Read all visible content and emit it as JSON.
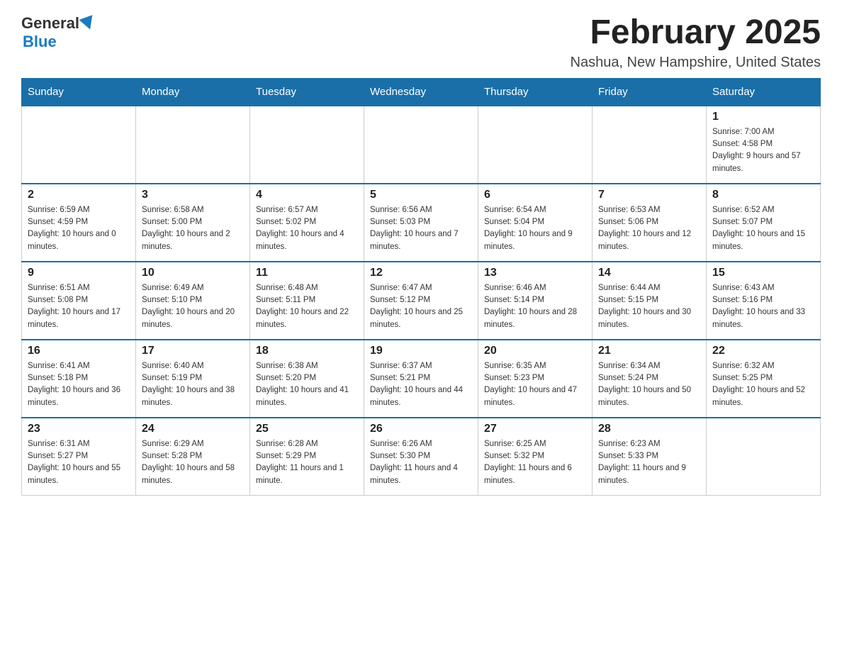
{
  "header": {
    "logo": {
      "text_general": "General",
      "text_blue": "Blue"
    },
    "title": "February 2025",
    "subtitle": "Nashua, New Hampshire, United States"
  },
  "calendar": {
    "days_of_week": [
      "Sunday",
      "Monday",
      "Tuesday",
      "Wednesday",
      "Thursday",
      "Friday",
      "Saturday"
    ],
    "weeks": [
      [
        {
          "day": "",
          "empty": true
        },
        {
          "day": "",
          "empty": true
        },
        {
          "day": "",
          "empty": true
        },
        {
          "day": "",
          "empty": true
        },
        {
          "day": "",
          "empty": true
        },
        {
          "day": "",
          "empty": true
        },
        {
          "day": "1",
          "sunrise": "Sunrise: 7:00 AM",
          "sunset": "Sunset: 4:58 PM",
          "daylight": "Daylight: 9 hours and 57 minutes."
        }
      ],
      [
        {
          "day": "2",
          "sunrise": "Sunrise: 6:59 AM",
          "sunset": "Sunset: 4:59 PM",
          "daylight": "Daylight: 10 hours and 0 minutes."
        },
        {
          "day": "3",
          "sunrise": "Sunrise: 6:58 AM",
          "sunset": "Sunset: 5:00 PM",
          "daylight": "Daylight: 10 hours and 2 minutes."
        },
        {
          "day": "4",
          "sunrise": "Sunrise: 6:57 AM",
          "sunset": "Sunset: 5:02 PM",
          "daylight": "Daylight: 10 hours and 4 minutes."
        },
        {
          "day": "5",
          "sunrise": "Sunrise: 6:56 AM",
          "sunset": "Sunset: 5:03 PM",
          "daylight": "Daylight: 10 hours and 7 minutes."
        },
        {
          "day": "6",
          "sunrise": "Sunrise: 6:54 AM",
          "sunset": "Sunset: 5:04 PM",
          "daylight": "Daylight: 10 hours and 9 minutes."
        },
        {
          "day": "7",
          "sunrise": "Sunrise: 6:53 AM",
          "sunset": "Sunset: 5:06 PM",
          "daylight": "Daylight: 10 hours and 12 minutes."
        },
        {
          "day": "8",
          "sunrise": "Sunrise: 6:52 AM",
          "sunset": "Sunset: 5:07 PM",
          "daylight": "Daylight: 10 hours and 15 minutes."
        }
      ],
      [
        {
          "day": "9",
          "sunrise": "Sunrise: 6:51 AM",
          "sunset": "Sunset: 5:08 PM",
          "daylight": "Daylight: 10 hours and 17 minutes."
        },
        {
          "day": "10",
          "sunrise": "Sunrise: 6:49 AM",
          "sunset": "Sunset: 5:10 PM",
          "daylight": "Daylight: 10 hours and 20 minutes."
        },
        {
          "day": "11",
          "sunrise": "Sunrise: 6:48 AM",
          "sunset": "Sunset: 5:11 PM",
          "daylight": "Daylight: 10 hours and 22 minutes."
        },
        {
          "day": "12",
          "sunrise": "Sunrise: 6:47 AM",
          "sunset": "Sunset: 5:12 PM",
          "daylight": "Daylight: 10 hours and 25 minutes."
        },
        {
          "day": "13",
          "sunrise": "Sunrise: 6:46 AM",
          "sunset": "Sunset: 5:14 PM",
          "daylight": "Daylight: 10 hours and 28 minutes."
        },
        {
          "day": "14",
          "sunrise": "Sunrise: 6:44 AM",
          "sunset": "Sunset: 5:15 PM",
          "daylight": "Daylight: 10 hours and 30 minutes."
        },
        {
          "day": "15",
          "sunrise": "Sunrise: 6:43 AM",
          "sunset": "Sunset: 5:16 PM",
          "daylight": "Daylight: 10 hours and 33 minutes."
        }
      ],
      [
        {
          "day": "16",
          "sunrise": "Sunrise: 6:41 AM",
          "sunset": "Sunset: 5:18 PM",
          "daylight": "Daylight: 10 hours and 36 minutes."
        },
        {
          "day": "17",
          "sunrise": "Sunrise: 6:40 AM",
          "sunset": "Sunset: 5:19 PM",
          "daylight": "Daylight: 10 hours and 38 minutes."
        },
        {
          "day": "18",
          "sunrise": "Sunrise: 6:38 AM",
          "sunset": "Sunset: 5:20 PM",
          "daylight": "Daylight: 10 hours and 41 minutes."
        },
        {
          "day": "19",
          "sunrise": "Sunrise: 6:37 AM",
          "sunset": "Sunset: 5:21 PM",
          "daylight": "Daylight: 10 hours and 44 minutes."
        },
        {
          "day": "20",
          "sunrise": "Sunrise: 6:35 AM",
          "sunset": "Sunset: 5:23 PM",
          "daylight": "Daylight: 10 hours and 47 minutes."
        },
        {
          "day": "21",
          "sunrise": "Sunrise: 6:34 AM",
          "sunset": "Sunset: 5:24 PM",
          "daylight": "Daylight: 10 hours and 50 minutes."
        },
        {
          "day": "22",
          "sunrise": "Sunrise: 6:32 AM",
          "sunset": "Sunset: 5:25 PM",
          "daylight": "Daylight: 10 hours and 52 minutes."
        }
      ],
      [
        {
          "day": "23",
          "sunrise": "Sunrise: 6:31 AM",
          "sunset": "Sunset: 5:27 PM",
          "daylight": "Daylight: 10 hours and 55 minutes."
        },
        {
          "day": "24",
          "sunrise": "Sunrise: 6:29 AM",
          "sunset": "Sunset: 5:28 PM",
          "daylight": "Daylight: 10 hours and 58 minutes."
        },
        {
          "day": "25",
          "sunrise": "Sunrise: 6:28 AM",
          "sunset": "Sunset: 5:29 PM",
          "daylight": "Daylight: 11 hours and 1 minute."
        },
        {
          "day": "26",
          "sunrise": "Sunrise: 6:26 AM",
          "sunset": "Sunset: 5:30 PM",
          "daylight": "Daylight: 11 hours and 4 minutes."
        },
        {
          "day": "27",
          "sunrise": "Sunrise: 6:25 AM",
          "sunset": "Sunset: 5:32 PM",
          "daylight": "Daylight: 11 hours and 6 minutes."
        },
        {
          "day": "28",
          "sunrise": "Sunrise: 6:23 AM",
          "sunset": "Sunset: 5:33 PM",
          "daylight": "Daylight: 11 hours and 9 minutes."
        },
        {
          "day": "",
          "empty": true
        }
      ]
    ]
  }
}
